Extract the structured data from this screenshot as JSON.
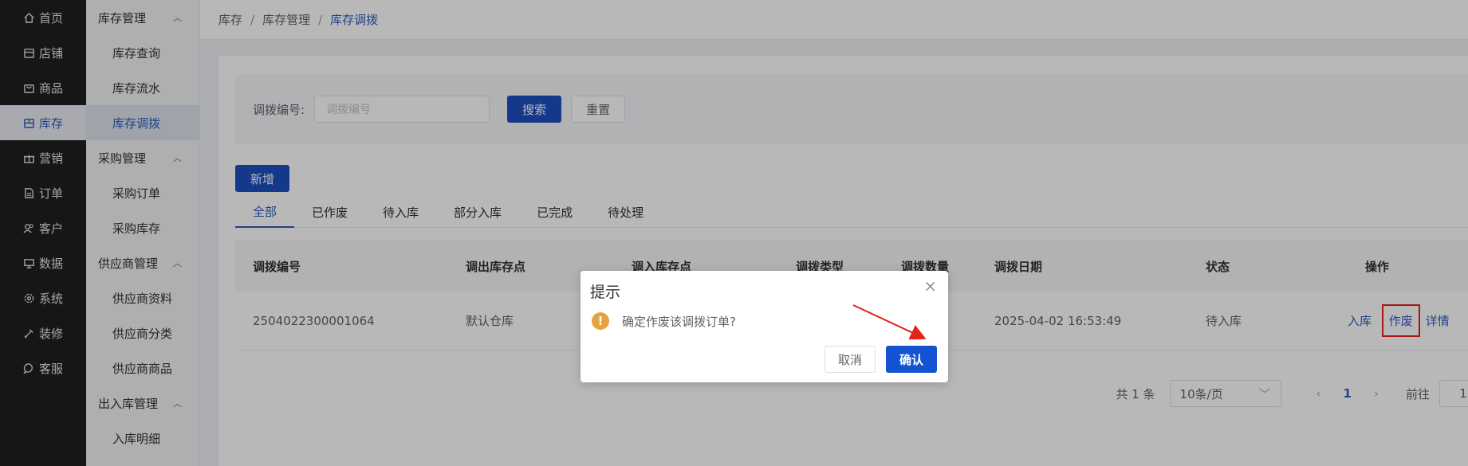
{
  "nav": {
    "items": [
      {
        "label": "首页",
        "icon": "home-icon"
      },
      {
        "label": "店铺",
        "icon": "store-icon"
      },
      {
        "label": "商品",
        "icon": "bag-icon"
      },
      {
        "label": "库存",
        "icon": "inventory-icon"
      },
      {
        "label": "营销",
        "icon": "gift-icon"
      },
      {
        "label": "订单",
        "icon": "document-icon"
      },
      {
        "label": "客户",
        "icon": "users-icon"
      },
      {
        "label": "数据",
        "icon": "chart-icon"
      },
      {
        "label": "系统",
        "icon": "gear-icon"
      },
      {
        "label": "装修",
        "icon": "brush-icon"
      },
      {
        "label": "客服",
        "icon": "chat-icon"
      }
    ]
  },
  "submenu": {
    "group1": "库存管理",
    "g1_items": [
      "库存查询",
      "库存流水",
      "库存调拨"
    ],
    "group2": "采购管理",
    "g2_items": [
      "采购订单",
      "采购库存"
    ],
    "group3": "供应商管理",
    "g3_items": [
      "供应商资料",
      "供应商分类",
      "供应商商品"
    ],
    "group4": "出入库管理",
    "g4_items": [
      "入库明细"
    ]
  },
  "breadcrumb": [
    "库存",
    "库存管理",
    "库存调拨"
  ],
  "search": {
    "label": "调拨编号:",
    "placeholder": "调拨编号",
    "search_btn": "搜索",
    "reset_btn": "重置"
  },
  "add_btn": "新增",
  "tabs": [
    "全部",
    "已作废",
    "待入库",
    "部分入库",
    "已完成",
    "待处理"
  ],
  "table": {
    "headers": [
      "调拨编号",
      "调出库存点",
      "调入库存点",
      "调拨类型",
      "调拨数量",
      "调拨日期",
      "状态",
      "操作"
    ],
    "row": {
      "id": "2504022300001064",
      "from": "默认仓库",
      "to": "",
      "type": "",
      "qty": "",
      "date": "2025-04-02 16:53:49",
      "status": "待入库",
      "op_in": "入库",
      "op_void": "作废",
      "op_detail": "详情"
    }
  },
  "pager": {
    "total": "共 1 条",
    "size": "10条/页",
    "page": "1",
    "goto": "前往",
    "goto_val": "1"
  },
  "dialog": {
    "title": "提示",
    "message": "确定作废该调拨订单?",
    "cancel": "取消",
    "confirm": "确认"
  },
  "colors": {
    "primary": "#1d4fbf",
    "warning": "#e6a23c",
    "annotation": "#e5211a"
  }
}
